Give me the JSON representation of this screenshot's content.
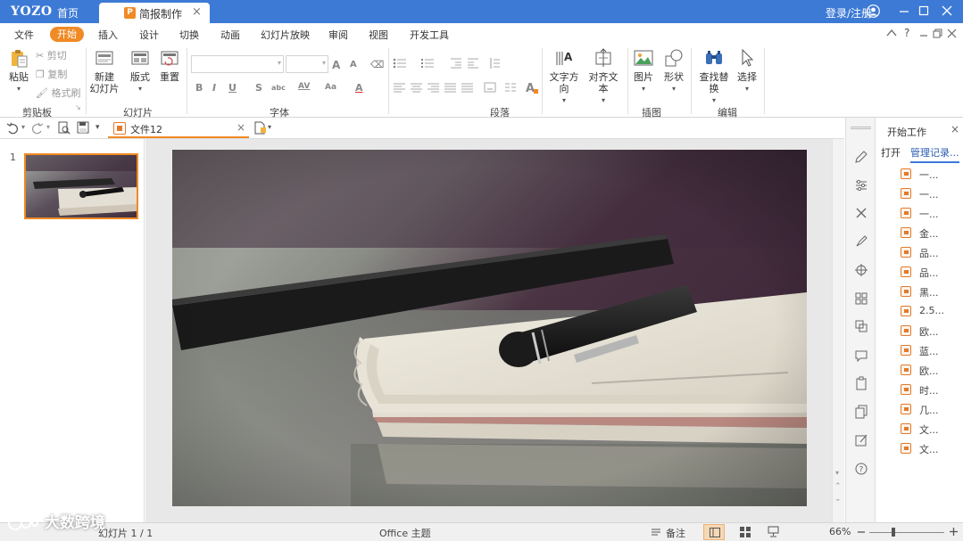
{
  "titlebar": {
    "logo": "YOZO",
    "home_tab": "首页",
    "doc_tab": "简报制作",
    "app_icon_letter": "P",
    "login": "登录/注册",
    "close_glyph": "×"
  },
  "menubar": {
    "items": [
      "文件",
      "开始",
      "插入",
      "设计",
      "切换",
      "动画",
      "幻灯片放映",
      "审阅",
      "视图",
      "开发工具"
    ],
    "active": "开始",
    "help": "?"
  },
  "ribbon": {
    "clipboard": {
      "paste": "粘贴",
      "cut": "剪切",
      "copy": "复制",
      "format_painter": "格式刷",
      "group": "剪贴板"
    },
    "slides": {
      "new_line1": "新建",
      "new_line2": "幻灯片",
      "layout": "版式",
      "reset": "重置",
      "group": "幻灯片"
    },
    "font": {
      "group": "字体",
      "bold": "B",
      "italic": "I",
      "underline": "U",
      "strike": "S",
      "abc": "abc",
      "av": "AV",
      "aa": "Aa",
      "color_a": "A",
      "grow": "A",
      "shrink": "A"
    },
    "paragraph": {
      "group": "段落"
    },
    "text": {
      "direction": "文字方向",
      "align": "对齐文本"
    },
    "insert": {
      "picture": "图片",
      "shape": "形状",
      "group": "插图"
    },
    "edit": {
      "find_replace": "查找替换",
      "select": "选择",
      "group": "编辑"
    }
  },
  "quickbar": {
    "file_tab": "文件12"
  },
  "thumbnails": [
    {
      "number": "1"
    }
  ],
  "right_panel": {
    "title": "开始工作",
    "tab_open": "打开",
    "tab_manage": "管理记录...",
    "items": [
      "一...",
      "一...",
      "一...",
      "金...",
      "品...",
      "品...",
      "黑...",
      "2.5...",
      "欧...",
      "蓝...",
      "欧...",
      "时...",
      "几...",
      "文...",
      "文..."
    ]
  },
  "statusbar": {
    "slide_info": "幻灯片 1 / 1",
    "theme": "Office 主题",
    "notes": "备注",
    "zoom": "66%"
  },
  "watermark": "大数跨境",
  "colors": {
    "titlebar": "#3d7ad6",
    "accent": "#f08a24"
  }
}
